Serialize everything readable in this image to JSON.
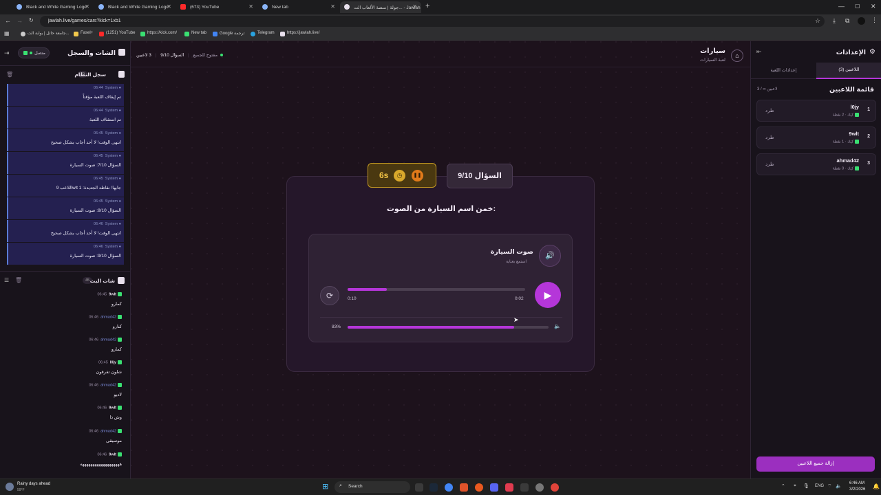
{
  "browser": {
    "tabs": [
      {
        "label": "Black and White Gaming Logo"
      },
      {
        "label": "Black and White Gaming Logo"
      },
      {
        "label": "(673) YouTube"
      },
      {
        "label": "New tab"
      },
      {
        "label": "جولة | منصة الألعاب الت... - Jawlah"
      }
    ],
    "url": "jawlah.live/games/cars?kick=1xb1",
    "bookmarks": [
      "جامعة حائل | بوابة الت...",
      "Fasel+",
      "(1251) YouTube",
      "https://kick.com/",
      "New tab",
      "Google ترجمة",
      "Telegram",
      "https://jawlah.live/"
    ]
  },
  "left_panel": {
    "title": "الشات والسجل",
    "status": "متصل",
    "system_log": {
      "title": "سجل النظام",
      "count": "29",
      "entries": [
        {
          "source": "System",
          "time": "06:44",
          "text": "تم إيقاف اللعبة مؤقتاً"
        },
        {
          "source": "System",
          "time": "06:44",
          "text": "تم استئناف اللعبة"
        },
        {
          "source": "System",
          "time": "06:45",
          "text": "انتهى الوقت! لا أحد أجاب بشكل صحيح"
        },
        {
          "source": "System",
          "time": "06:45",
          "text": "السؤال 7/10: صوت السيارة"
        },
        {
          "source": "System",
          "time": "06:45",
          "text": "اللاعب 9wlt جابها! نقاطه الجديدة: 1"
        },
        {
          "source": "System",
          "time": "06:45",
          "text": "السؤال 8/10: صوت السيارة"
        },
        {
          "source": "System",
          "time": "06:46",
          "text": "انتهى الوقت! لا أحد أجاب بشكل صحيح"
        },
        {
          "source": "System",
          "time": "06:46",
          "text": "السؤال 9/10: صوت السيارة"
        }
      ]
    },
    "live_chat": {
      "title": "شات البث",
      "count": "45",
      "messages": [
        {
          "user": "9wlt",
          "time": "06:45",
          "text": "كمارو"
        },
        {
          "user": "ahmad42",
          "time": "06:46",
          "text": "كنارو"
        },
        {
          "user": "ahmad42",
          "time": "06:46",
          "text": "كمارو"
        },
        {
          "user": "l0jy",
          "time": "06:45",
          "text": "شلون تفرقون"
        },
        {
          "user": "ahmad42",
          "time": "06:46",
          "text": "لاديو"
        },
        {
          "user": "9wlt",
          "time": "06:46",
          "text": "وش ذا"
        },
        {
          "user": "ahmad42",
          "time": "06:46",
          "text": "موسيقى"
        },
        {
          "user": "9wlt",
          "time": "06:46",
          "text": "هههههههههههههههههههه"
        }
      ]
    }
  },
  "main": {
    "game_title": "سيارات",
    "game_subtitle": "لعبة السيارات",
    "status_players": "3 لاعبين",
    "status_question": "السؤال 9/10",
    "status_open": "مفتوح للجميع",
    "question_badge": "السؤال 9/10",
    "timer": "6s",
    "prompt": "خمن اسم السيارة من الصوت:",
    "audio": {
      "title": "صوت السيارة",
      "subtitle": "استمع بعناية",
      "total_time": "0:10",
      "current_time": "0:02",
      "progress": 0.22,
      "volume_label": "83%",
      "volume": 0.83
    }
  },
  "right_panel": {
    "title": "الإعدادات",
    "tab_players": "اللاعبين (3)",
    "tab_settings": "إعدادات اللعبة",
    "list_title": "قائمة اللاعبين",
    "list_count": "3 / ∞ لاعبين",
    "kick_label": "طرد",
    "players": [
      {
        "rank": "1",
        "name": "l0jy",
        "detail": "كيك · 2 نقطة"
      },
      {
        "rank": "2",
        "name": "9wlt",
        "detail": "كيك · 1 نقطة"
      },
      {
        "rank": "3",
        "name": "ahmad42",
        "detail": "كيك · 0 نقطة"
      }
    ],
    "remove_all": "إزالة جميع اللاعبين"
  },
  "taskbar": {
    "weather_title": "Rainy days ahead",
    "weather_temp": "59°F",
    "search": "Search",
    "lang": "ENG",
    "time": "6:46 AM",
    "date": "3/2/2026"
  },
  "colors": {
    "accent": "#b536d9",
    "gold": "#c49a22",
    "kick": "#3ae072"
  }
}
